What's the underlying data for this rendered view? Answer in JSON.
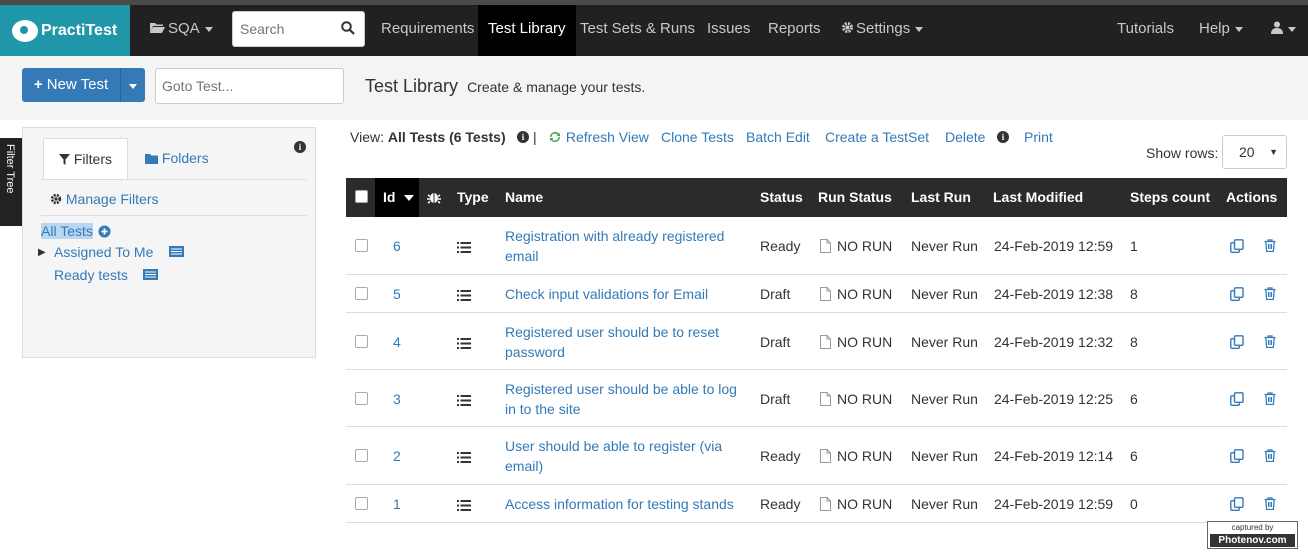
{
  "brand": {
    "name": "PractiTest"
  },
  "nav": {
    "project": "SQA",
    "search_placeholder": "Search",
    "items": [
      "Requirements",
      "Test Library",
      "Test Sets & Runs",
      "Issues",
      "Reports"
    ],
    "settings": "Settings",
    "tutorials": "Tutorials",
    "help": "Help"
  },
  "subbar": {
    "new_test": "New Test",
    "goto_placeholder": "Goto Test...",
    "title": "Test Library",
    "subtitle": "Create & manage your tests."
  },
  "sidebar": {
    "filter_tree_tab": "Filter Tree",
    "tabs": [
      "Filters",
      "Folders"
    ],
    "manage_filters": "Manage Filters",
    "filters": [
      "All Tests",
      "Assigned To Me",
      "Ready tests"
    ]
  },
  "toolbar": {
    "view_label": "View:",
    "view_value": "All Tests (6 Tests)",
    "refresh": "Refresh View",
    "clone": "Clone Tests",
    "batch_edit": "Batch Edit",
    "create_testset": "Create a TestSet",
    "delete": "Delete",
    "print": "Print",
    "show_rows_label": "Show rows:",
    "show_rows_value": "20"
  },
  "table": {
    "columns": [
      "Id",
      "Type",
      "Name",
      "Status",
      "Run Status",
      "Last Run",
      "Last Modified",
      "Steps count",
      "Actions"
    ],
    "rows": [
      {
        "id": "6",
        "name": "Registration with already registered email",
        "status": "Ready",
        "run_status": "NO RUN",
        "last_run": "Never Run",
        "last_modified": "24-Feb-2019 12:59",
        "steps": "1"
      },
      {
        "id": "5",
        "name": "Check input validations for Email",
        "status": "Draft",
        "run_status": "NO RUN",
        "last_run": "Never Run",
        "last_modified": "24-Feb-2019 12:38",
        "steps": "8"
      },
      {
        "id": "4",
        "name": "Registered user should be to reset password",
        "status": "Draft",
        "run_status": "NO RUN",
        "last_run": "Never Run",
        "last_modified": "24-Feb-2019 12:32",
        "steps": "8"
      },
      {
        "id": "3",
        "name": "Registered user should be able to log in to the site",
        "status": "Draft",
        "run_status": "NO RUN",
        "last_run": "Never Run",
        "last_modified": "24-Feb-2019 12:25",
        "steps": "6"
      },
      {
        "id": "2",
        "name": "User should be able to register (via email)",
        "status": "Ready",
        "run_status": "NO RUN",
        "last_run": "Never Run",
        "last_modified": "24-Feb-2019 12:14",
        "steps": "6"
      },
      {
        "id": "1",
        "name": "Access information for testing stands",
        "status": "Ready",
        "run_status": "NO RUN",
        "last_run": "Never Run",
        "last_modified": "24-Feb-2019 12:59",
        "steps": "0"
      }
    ]
  },
  "watermark": {
    "line1": "captured by",
    "line2": "Photenov.com"
  },
  "colors": {
    "brand": "#1f97a8",
    "navbar": "#212121",
    "link": "#337ab7",
    "header": "#2b2b2b"
  }
}
